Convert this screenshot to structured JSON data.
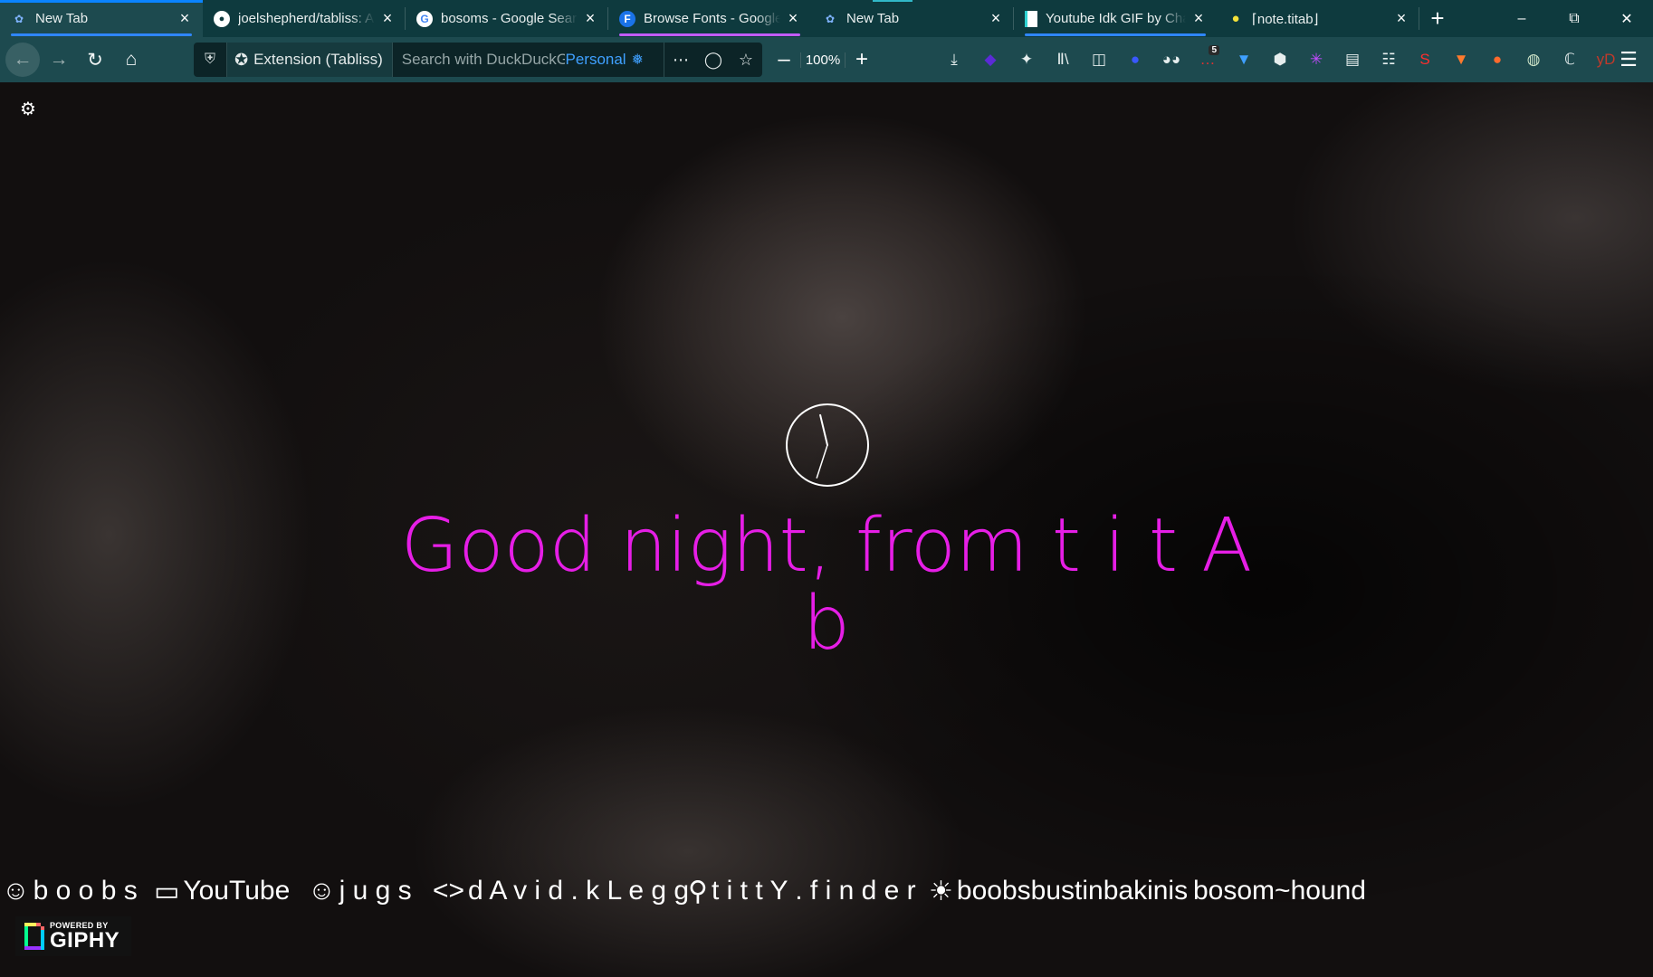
{
  "tabs": [
    {
      "title": "New Tab",
      "icon": "tabliss-icon"
    },
    {
      "title": "joelshepherd/tabliss: A",
      "icon": "github-icon"
    },
    {
      "title": "bosoms - Google Searc",
      "icon": "google-icon"
    },
    {
      "title": "Browse Fonts - Google",
      "icon": "google-fonts-icon",
      "icon_letter": "F"
    },
    {
      "title": "New Tab",
      "icon": "tabliss-icon"
    },
    {
      "title": "Youtube Idk GIF by Cha",
      "icon": "document-icon"
    },
    {
      "title": "⌈note.titab⌋",
      "icon": "lemon-icon"
    }
  ],
  "window_controls": {
    "minimize": "–",
    "restore": "⧉",
    "close": "✕"
  },
  "nav": {
    "back_icon": "←",
    "forward_icon": "→",
    "reload_icon": "↻",
    "home_icon": "⌂"
  },
  "urlbar": {
    "identity_label": "Extension (Tabliss)",
    "search_placeholder": "Search with DuckDuckGo",
    "container_label": "Personal",
    "zoom_value": "100%"
  },
  "extensions": [
    {
      "name": "download-icon",
      "glyph": "⤓"
    },
    {
      "name": "stack-icon",
      "glyph": "◆",
      "color": "#5b2bd6"
    },
    {
      "name": "puzzle-icon",
      "glyph": "✦"
    },
    {
      "name": "library-icon",
      "glyph": "Ⅱ\\"
    },
    {
      "name": "sidebar-icon",
      "glyph": "◫"
    },
    {
      "name": "blue-dot-icon",
      "glyph": "●",
      "color": "#3a58ff"
    },
    {
      "name": "eyes-icon",
      "glyph": "◕◕"
    },
    {
      "name": "message-icon",
      "glyph": "…",
      "color": "#e53030",
      "badge": "5"
    },
    {
      "name": "diamond-icon",
      "glyph": "▼",
      "color": "#3fa0ff"
    },
    {
      "name": "ublock-icon",
      "glyph": "⬢"
    },
    {
      "name": "sparkle-icon",
      "glyph": "✳",
      "color": "#c24bff"
    },
    {
      "name": "reader-icon",
      "glyph": "▤"
    },
    {
      "name": "grid-icon",
      "glyph": "☷"
    },
    {
      "name": "s-icon",
      "glyph": "S",
      "color": "#ff2d2d"
    },
    {
      "name": "cup-icon",
      "glyph": "▼",
      "color": "#ff7a2d"
    },
    {
      "name": "duckduckgo-icon",
      "glyph": "●",
      "color": "#ff6a2d"
    },
    {
      "name": "globe-icon",
      "glyph": "◍",
      "color": "#cfe5c9"
    },
    {
      "name": "translate-icon",
      "glyph": "ℂ"
    },
    {
      "name": "yd-icon",
      "glyph": "yD",
      "color": "#c0392b"
    }
  ],
  "settings_icon": "⚙",
  "clock": {
    "hour": 11,
    "minute": 33
  },
  "greeting": "Good night, from t i t A b",
  "greeting_color": "#e61ee6",
  "links": [
    {
      "icon": "smile-icon",
      "glyph": "☺",
      "label": "b o o b s"
    },
    {
      "icon": "video-icon",
      "glyph": "▭",
      "label": "YouTube"
    },
    {
      "icon": "smile-icon",
      "glyph": "☺",
      "label": "j u g s"
    },
    {
      "icon": "code-icon",
      "glyph": "<>",
      "label": "d A v i d . k L e g g"
    },
    {
      "icon": "search-icon",
      "glyph": "⚲",
      "label": "t i t t Y . f i n d e r"
    },
    {
      "icon": "sun-icon",
      "glyph": "☀",
      "label": "boobsbustinbakinis"
    },
    {
      "icon": "",
      "glyph": "",
      "label": "bosom~hound"
    }
  ],
  "giphy": {
    "powered_by": "POWERED BY",
    "brand": "GIPHY"
  },
  "accent_blue": "#0a84ff",
  "tab_bg": "#0e3a3e",
  "toolbar_bg": "#1d4a4f"
}
